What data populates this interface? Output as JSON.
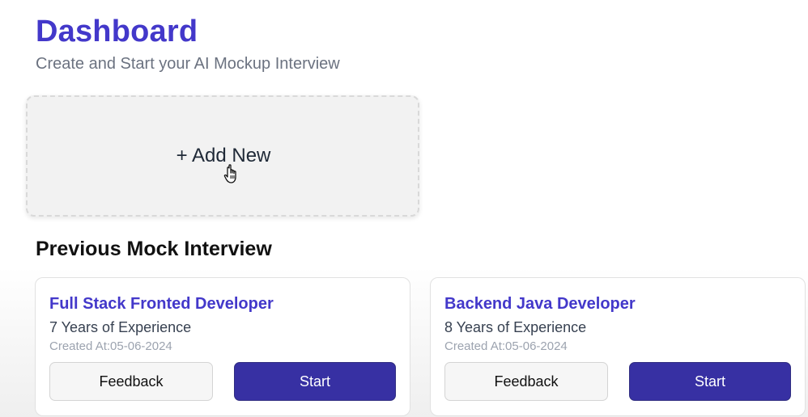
{
  "header": {
    "title": "Dashboard",
    "subtitle": "Create and Start your AI Mockup Interview"
  },
  "add_new": {
    "label": "+ Add New",
    "cursor_icon": "hand-pointer-icon"
  },
  "previous": {
    "section_title": "Previous Mock Interview",
    "interviews": [
      {
        "role": "Full Stack Fronted Developer",
        "experience": "7 Years of Experience",
        "created": "Created At:05-06-2024",
        "feedback_label": "Feedback",
        "start_label": "Start"
      },
      {
        "role": "Backend Java Developer",
        "experience": "8 Years of Experience",
        "created": "Created At:05-06-2024",
        "feedback_label": "Feedback",
        "start_label": "Start"
      }
    ]
  },
  "colors": {
    "accent": "#4338ca",
    "button_primary": "#3730a3",
    "muted_text": "#6b7280"
  }
}
